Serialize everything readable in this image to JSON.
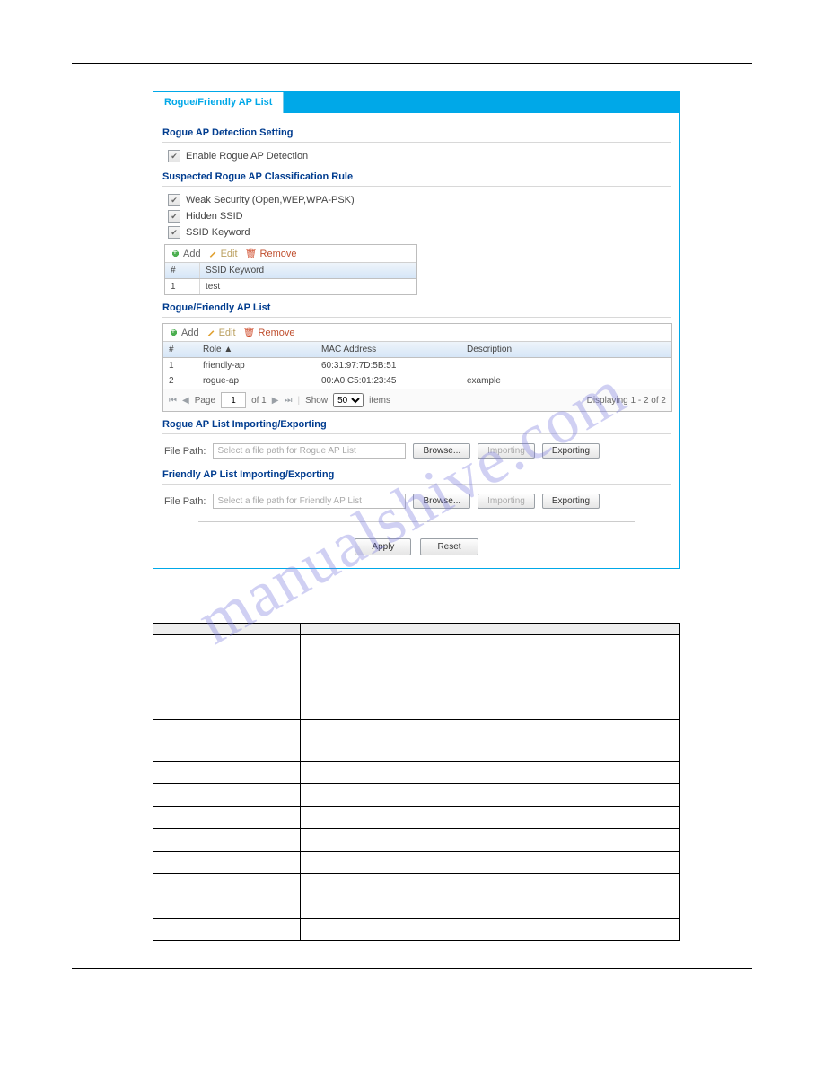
{
  "tab": {
    "label": "Rogue/Friendly AP List"
  },
  "section1": {
    "title": "Rogue AP Detection Setting",
    "enable_label": "Enable Rogue AP Detection"
  },
  "section2": {
    "title": "Suspected Rogue AP Classification Rule",
    "weak_label": "Weak Security (Open,WEP,WPA-PSK)",
    "hidden_label": "Hidden SSID",
    "kw_label": "SSID Keyword",
    "toolbar": {
      "add": "Add",
      "edit": "Edit",
      "remove": "Remove"
    },
    "thead": {
      "idx": "#",
      "kw": "SSID Keyword"
    },
    "rows": [
      {
        "idx": "1",
        "kw": "test"
      }
    ]
  },
  "section3": {
    "title": "Rogue/Friendly AP List",
    "toolbar": {
      "add": "Add",
      "edit": "Edit",
      "remove": "Remove"
    },
    "thead": {
      "idx": "#",
      "role": "Role ▲",
      "mac": "MAC Address",
      "desc": "Description"
    },
    "rows": [
      {
        "idx": "1",
        "role": "friendly-ap",
        "mac": "60:31:97:7D:5B:51",
        "desc": ""
      },
      {
        "idx": "2",
        "role": "rogue-ap",
        "mac": "00:A0:C5:01:23:45",
        "desc": "example"
      }
    ],
    "pager": {
      "page_label": "Page",
      "page": "1",
      "of_label": "of 1",
      "show_label": "Show",
      "show": "50",
      "items_label": "items",
      "display": "Displaying 1 - 2 of 2"
    }
  },
  "section4": {
    "title": "Rogue AP List Importing/Exporting",
    "file_label": "File Path:",
    "placeholder": "Select a file path for Rogue AP List",
    "browse": "Browse...",
    "import": "Importing",
    "export": "Exporting"
  },
  "section5": {
    "title": "Friendly AP List Importing/Exporting",
    "file_label": "File Path:",
    "placeholder": "Select a file path for Friendly AP List",
    "browse": "Browse...",
    "import": "Importing",
    "export": "Exporting"
  },
  "buttons": {
    "apply": "Apply",
    "reset": "Reset"
  },
  "watermark": "manualshive.com"
}
